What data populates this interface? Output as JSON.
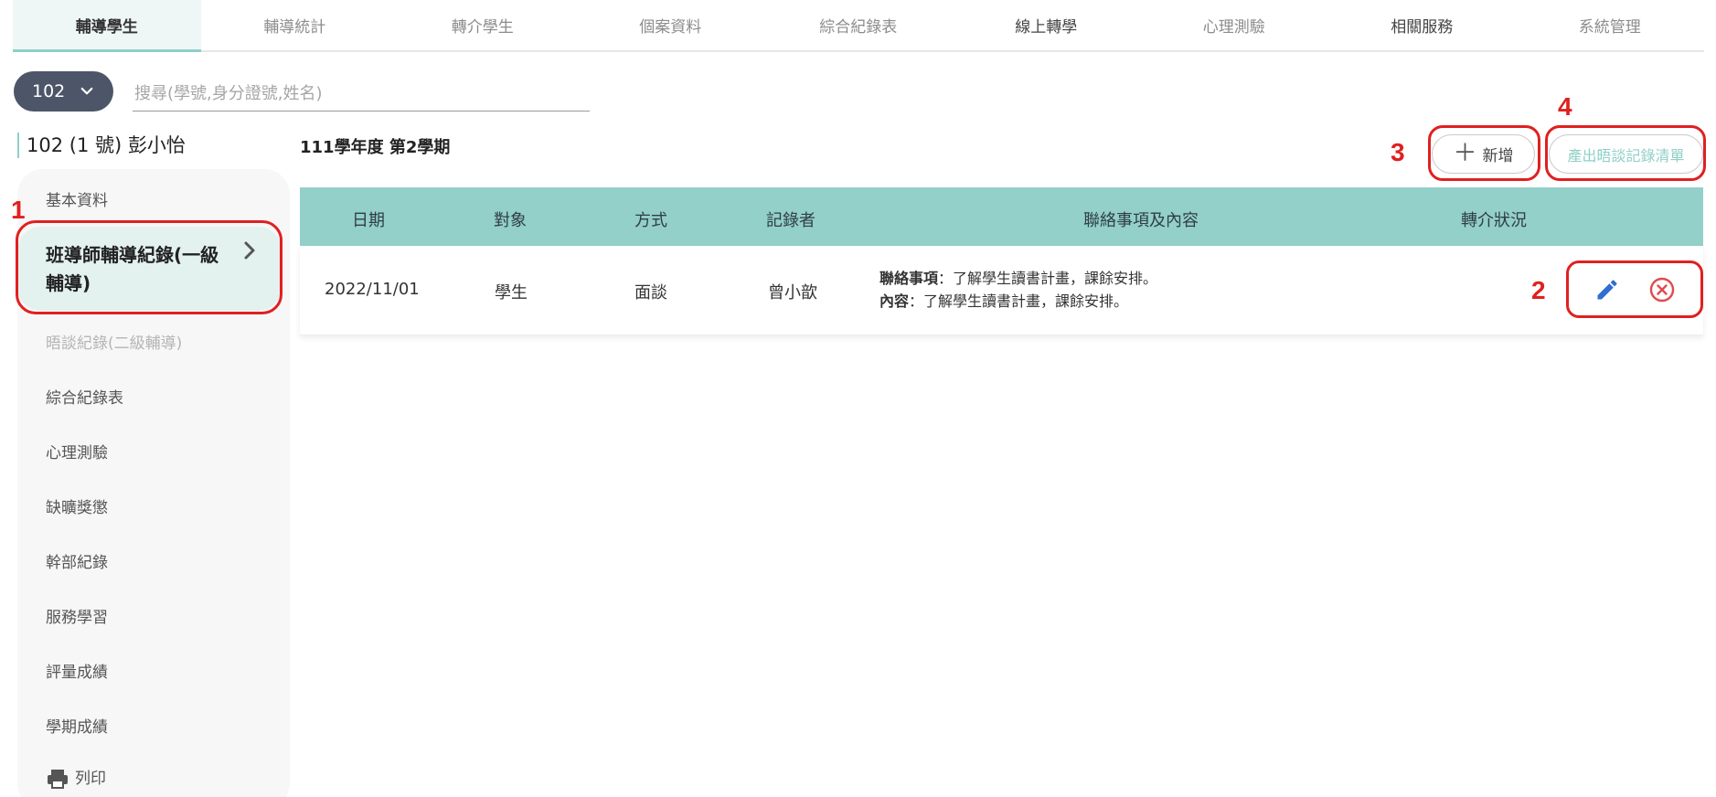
{
  "topnav": {
    "tabs": [
      {
        "label": "輔導學生"
      },
      {
        "label": "輔導統計"
      },
      {
        "label": "轉介學生"
      },
      {
        "label": "個案資料"
      },
      {
        "label": "綜合紀錄表"
      },
      {
        "label": "線上轉學"
      },
      {
        "label": "心理測驗"
      },
      {
        "label": "相關服務"
      },
      {
        "label": "系統管理"
      }
    ],
    "active_index": 0
  },
  "class_select": {
    "value": "102"
  },
  "search": {
    "placeholder": "搜尋(學號,身分證號,姓名)"
  },
  "student": {
    "title": "102 (1 號)  彭小怡"
  },
  "sidebar": {
    "items": [
      {
        "label": "基本資料"
      },
      {
        "label": "班導師輔導紀錄(一級輔導)"
      },
      {
        "label": "晤談紀錄(二級輔導)"
      },
      {
        "label": "綜合紀錄表"
      },
      {
        "label": "心理測驗"
      },
      {
        "label": "缺曠獎懲"
      },
      {
        "label": "幹部紀錄"
      },
      {
        "label": "服務學習"
      },
      {
        "label": "評量成績"
      },
      {
        "label": "學期成績"
      },
      {
        "label": "列印"
      }
    ]
  },
  "main": {
    "term_title": "111學年度 第2學期",
    "add_button": "新增",
    "export_button": "產出晤談記錄清單",
    "table": {
      "headers": [
        "日期",
        "對象",
        "方式",
        "記錄者",
        "聯絡事項及內容",
        "轉介狀況"
      ],
      "rows": [
        {
          "date": "2022/11/01",
          "target": "學生",
          "method": "面談",
          "recorder": "曾小歆",
          "contact_label": "聯絡事項",
          "contact_text": "：了解學生讀書計畫，課餘安排。",
          "content_label": "內容",
          "content_text": "：了解學生讀書計畫，課餘安排。",
          "referral": ""
        }
      ]
    }
  },
  "annotations": {
    "n1": "1",
    "n2": "2",
    "n3": "3",
    "n4": "4"
  },
  "colors": {
    "accent": "#93d0c9",
    "annotation": "#e02020",
    "select_bg": "#4c5668"
  }
}
